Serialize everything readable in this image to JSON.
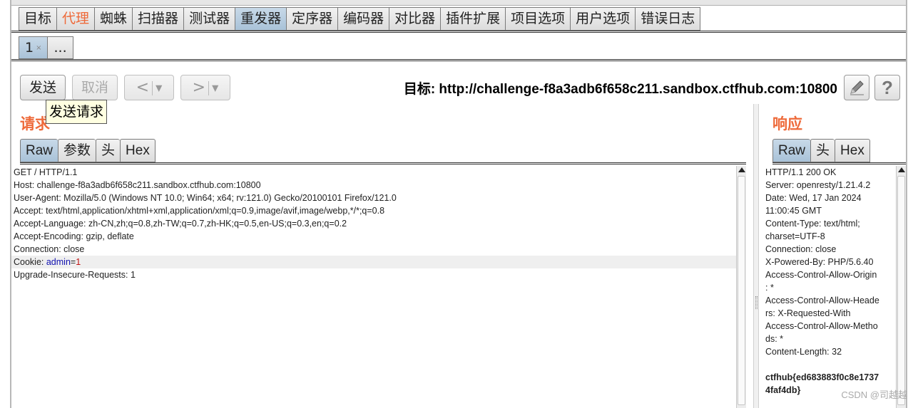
{
  "main_tabs": [
    {
      "label": "目标",
      "state": "normal"
    },
    {
      "label": "代理",
      "state": "orange"
    },
    {
      "label": "蜘蛛",
      "state": "normal"
    },
    {
      "label": "扫描器",
      "state": "normal"
    },
    {
      "label": "测试器",
      "state": "normal"
    },
    {
      "label": "重发器",
      "state": "active"
    },
    {
      "label": "定序器",
      "state": "normal"
    },
    {
      "label": "编码器",
      "state": "normal"
    },
    {
      "label": "对比器",
      "state": "normal"
    },
    {
      "label": "插件扩展",
      "state": "normal"
    },
    {
      "label": "项目选项",
      "state": "normal"
    },
    {
      "label": "用户选项",
      "state": "normal"
    },
    {
      "label": "错误日志",
      "state": "normal"
    }
  ],
  "sub_tabs": {
    "tab1": "1",
    "tab1_close": "×",
    "more": "..."
  },
  "toolbar": {
    "send": "发送",
    "cancel": "取消",
    "back_arrow": "<",
    "forward_arrow": ">",
    "dropdown": "▼",
    "tooltip": "发送请求",
    "target_label": "目标:",
    "target_url": "http://challenge-f8a3adb6f658c211.sandbox.ctfhub.com:10800",
    "edit_icon": "pencil-icon",
    "help_icon": "?"
  },
  "request": {
    "heading": "请求",
    "tabs": [
      "Raw",
      "参数",
      "头",
      "Hex"
    ],
    "lines": [
      "GET / HTTP/1.1",
      "Host: challenge-f8a3adb6f658c211.sandbox.ctfhub.com:10800",
      "User-Agent: Mozilla/5.0 (Windows NT 10.0; Win64; x64; rv:121.0) Gecko/20100101 Firefox/121.0",
      "Accept: text/html,application/xhtml+xml,application/xml;q=0.9,image/avif,image/webp,*/*;q=0.8",
      "Accept-Language: zh-CN,zh;q=0.8,zh-TW;q=0.7,zh-HK;q=0.5,en-US;q=0.3,en;q=0.2",
      "Accept-Encoding: gzip, deflate",
      "Connection: close"
    ],
    "cookie": {
      "prefix": "Cookie: ",
      "key": "admin",
      "eq": "=",
      "value": "1"
    },
    "last_line": "Upgrade-Insecure-Requests: 1"
  },
  "response": {
    "heading": "响应",
    "tabs": [
      "Raw",
      "头",
      "Hex"
    ],
    "lines": [
      "HTTP/1.1 200 OK",
      "Server: openresty/1.21.4.2",
      "Date: Wed, 17 Jan 2024",
      "11:00:45 GMT",
      "Content-Type: text/html;",
      "charset=UTF-8",
      "Connection: close",
      "X-Powered-By: PHP/5.6.40",
      "Access-Control-Allow-Origin",
      ": *",
      "Access-Control-Allow-Heade",
      "rs: X-Requested-With",
      "Access-Control-Allow-Metho",
      "ds: *",
      "Content-Length: 32",
      "",
      "ctfhub{ed683883f0c8e1737",
      "4faf4db}"
    ]
  },
  "watermark": "CSDN @司越越",
  "colors": {
    "accent_orange": "#ee6a3a",
    "active_tab": "#b8cde0",
    "tooltip_bg": "#ffffe1"
  }
}
